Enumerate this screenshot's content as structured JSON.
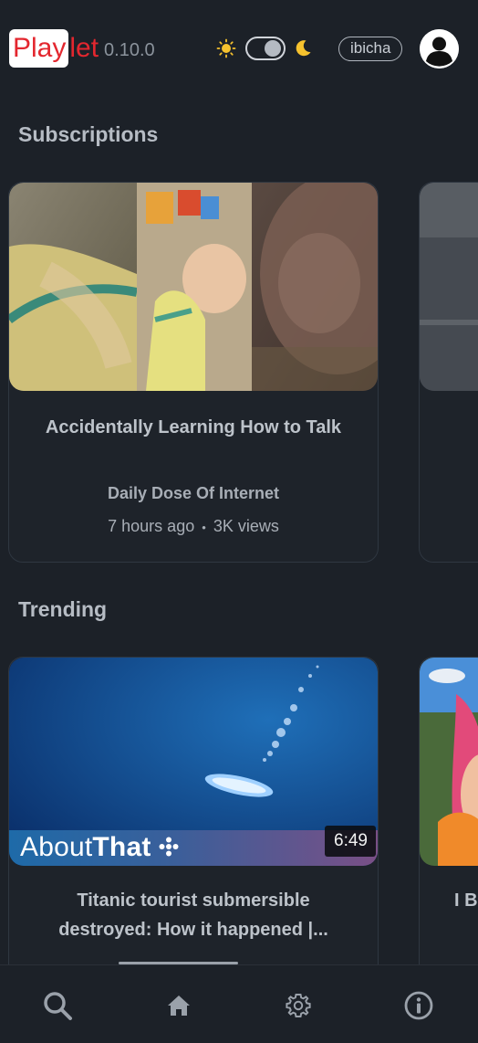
{
  "app": {
    "logo_play": "Play",
    "logo_let": "let",
    "version": "0.10.0",
    "username": "ibicha",
    "theme": "dark"
  },
  "icons": {
    "sun": "sun-icon",
    "moon": "moon-icon",
    "avatar": "user-avatar-icon",
    "search": "search-icon",
    "home": "home-icon",
    "settings": "gear-icon",
    "info": "info-icon"
  },
  "colors": {
    "background": "#1c2128",
    "brand_red": "#e3272f",
    "card_border": "#2f3741"
  },
  "sections": {
    "subscriptions": {
      "title": "Subscriptions",
      "video": {
        "title": "Accidentally Learning How to Talk",
        "channel": "Daily Dose Of Internet",
        "published": "7 hours ago",
        "separator": "•",
        "views": "3K views"
      }
    },
    "trending": {
      "title": "Trending",
      "video": {
        "title": "Titanic tourist submersible destroyed: How it happened |...",
        "duration": "6:49",
        "thumbnail_text_light": "About",
        "thumbnail_text_bold": "That"
      },
      "next_video_title_partial": "I B"
    }
  }
}
